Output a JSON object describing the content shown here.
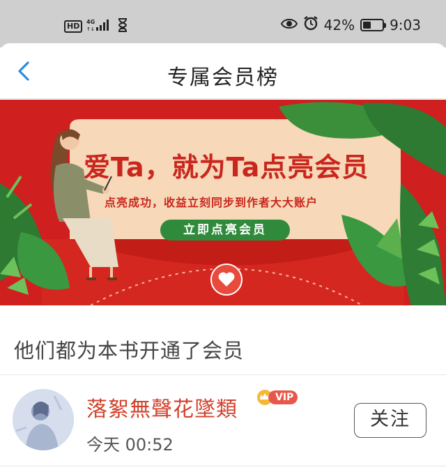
{
  "status_bar": {
    "hd": "HD",
    "network": "4G",
    "battery": "42%",
    "battery_level": 0.42,
    "time": "9:03"
  },
  "nav": {
    "title": "专属会员榜",
    "back_icon": "chevron-left-icon"
  },
  "banner": {
    "title": "爱Ta，就为Ta点亮会员",
    "subtitle": "点亮成功，收益立刻同步到作者大大账户",
    "button": "立即点亮会员",
    "colors": {
      "background": "#cf1f1e",
      "card": "#f7d8b8",
      "button": "#2f8a3c",
      "text": "#c9261e"
    }
  },
  "section": {
    "title": "他们都为本书开通了会员"
  },
  "members": [
    {
      "name": "落絮無聲花墜類",
      "badge": "VIP",
      "time": "今天 00:52",
      "follow_label": "关注"
    }
  ]
}
